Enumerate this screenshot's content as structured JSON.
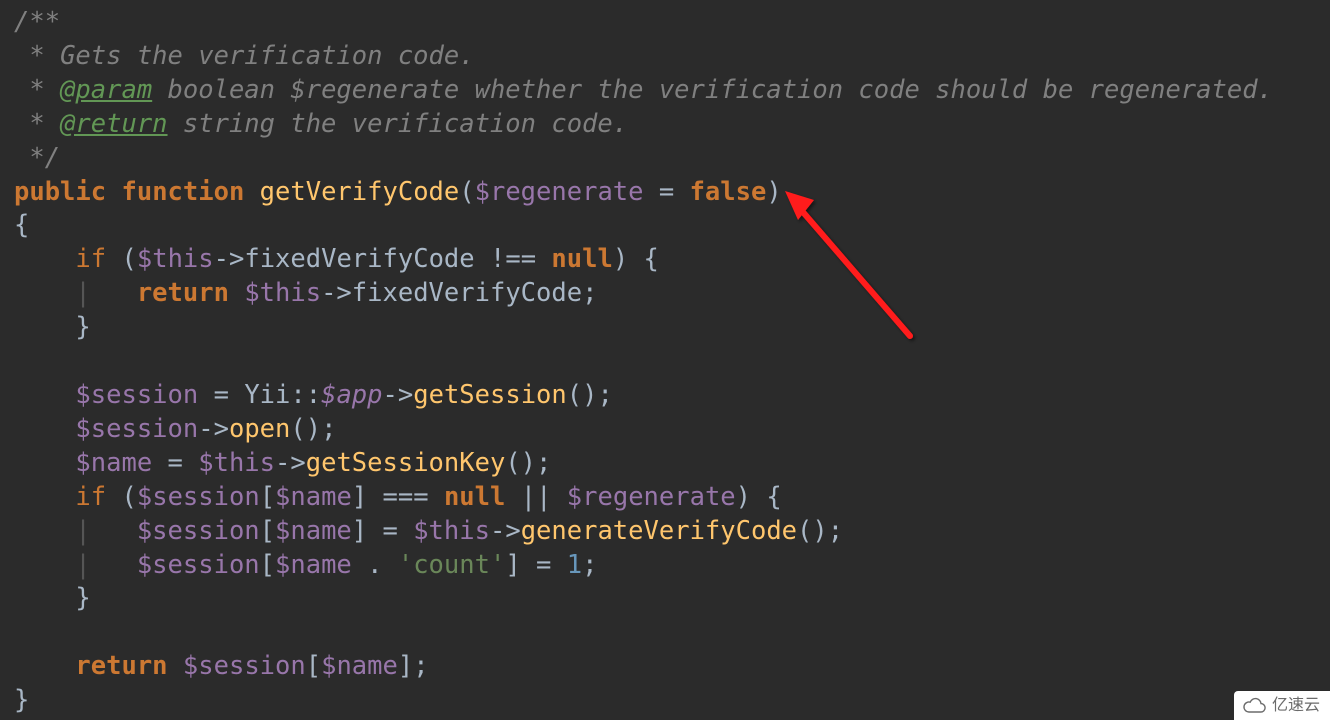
{
  "code": {
    "comment": {
      "open": "/**",
      "line1_prefix": " * ",
      "line1_text": "Gets the verification code.",
      "line2_prefix": " * ",
      "line2_tag": "@param",
      "line2_text": " boolean $regenerate whether the verification code should be regenerated.",
      "line3_prefix": " * ",
      "line3_tag": "@return",
      "line3_text": " string the verification code.",
      "close": " */"
    },
    "sig": {
      "public": "public",
      "function": "function",
      "name": "getVerifyCode",
      "lp": "(",
      "param": "$regenerate",
      "eq": " = ",
      "false": "false",
      "rp": ")"
    },
    "body": {
      "lbrace": "{",
      "if1_if": "if",
      "if1_lp": " (",
      "if1_this": "$this",
      "if1_arrow1": "->",
      "if1_prop": "fixedVerifyCode",
      "if1_neq": " !== ",
      "if1_null": "null",
      "if1_rp": ") {",
      "ret1_return": "return",
      "ret1_sp": " ",
      "ret1_this": "$this",
      "ret1_arrow": "->",
      "ret1_prop": "fixedVerifyCode",
      "ret1_semi": ";",
      "if1_close": "}",
      "s1_var": "$session",
      "s1_eq": " = ",
      "s1_cls": "Yii",
      "s1_dcolon": "::",
      "s1_app": "$app",
      "s1_arrow": "->",
      "s1_call": "getSession",
      "s1_paren": "();",
      "s2_var": "$session",
      "s2_arrow": "->",
      "s2_call": "open",
      "s2_paren": "();",
      "s3_var": "$name",
      "s3_eq": " = ",
      "s3_this": "$this",
      "s3_arrow": "->",
      "s3_call": "getSessionKey",
      "s3_paren": "();",
      "if2_if": "if",
      "if2_lp": " (",
      "if2_sess": "$session",
      "if2_lb": "[",
      "if2_name": "$name",
      "if2_rb": "]",
      "if2_eqq": " === ",
      "if2_null": "null",
      "if2_or": " || ",
      "if2_regen": "$regenerate",
      "if2_rp": ") {",
      "a1_sess": "$session",
      "a1_lb": "[",
      "a1_name": "$name",
      "a1_rb": "]",
      "a1_eq": " = ",
      "a1_this": "$this",
      "a1_arrow": "->",
      "a1_call": "generateVerifyCode",
      "a1_paren": "();",
      "a2_sess": "$session",
      "a2_lb": "[",
      "a2_name": "$name",
      "a2_dot": " . ",
      "a2_str": "'count'",
      "a2_rb": "]",
      "a2_eq": " = ",
      "a2_num": "1",
      "a2_semi": ";",
      "if2_close": "}",
      "ret2_return": "return",
      "ret2_sp": " ",
      "ret2_sess": "$session",
      "ret2_lb": "[",
      "ret2_name": "$name",
      "ret2_rb": "];",
      "rbrace": "}"
    }
  },
  "watermark": {
    "text": "亿速云"
  },
  "arrow": {
    "color": "#ff1a1a"
  }
}
